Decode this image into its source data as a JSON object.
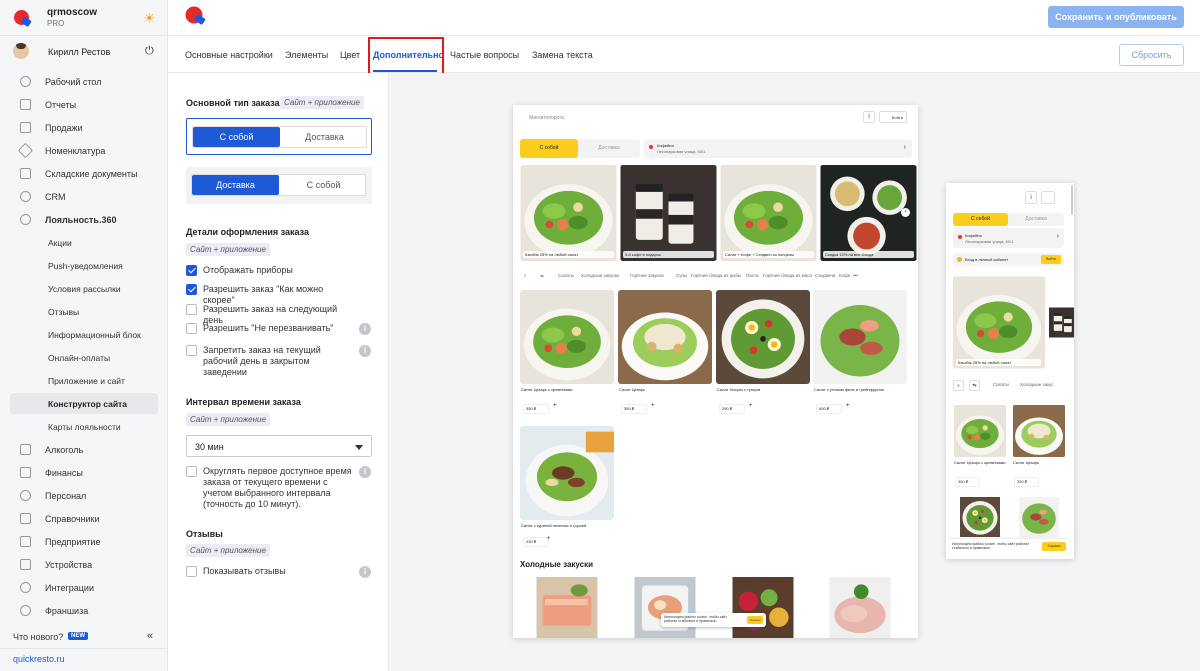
{
  "sidebar": {
    "account_name": "qrmoscow",
    "account_plan": "PRO",
    "user_name": "Кирилл Рестов",
    "nav": [
      "Рабочий стол",
      "Отчеты",
      "Продажи",
      "Номенклатура",
      "Складские документы",
      "CRM",
      "Лояльность.360"
    ],
    "loyalty_sub": [
      "Акции",
      "Push-уведомления",
      "Условия рассылки",
      "Отзывы",
      "Информационный блок",
      "Онлайн-оплаты",
      "Приложение и сайт",
      "Конструктор сайта",
      "Карты лояльности"
    ],
    "nav2": [
      "Алкоголь",
      "Финансы",
      "Персонал",
      "Справочники",
      "Предприятие",
      "Устройства",
      "Интеграции",
      "Франшиза"
    ],
    "whats_new": "Что нового?",
    "new_badge": "NEW",
    "site_link": "quickresto.ru",
    "collapse": "«"
  },
  "topbar": {
    "save_label": "Сохранить и опубликовать"
  },
  "tabs": {
    "items": [
      "Основные настройки",
      "Элементы",
      "Цвет",
      "Дополнительно",
      "Частые вопросы",
      "Замена текста"
    ],
    "active_index": 3,
    "reset_label": "Сбросить"
  },
  "settings": {
    "order_type": {
      "title": "Основной тип заказа",
      "badge": "Сайт + приложение",
      "opt1_a": "С собой",
      "opt1_b": "Доставка",
      "opt2_a": "Доставка",
      "opt2_b": "С собой"
    },
    "details": {
      "title": "Детали оформления заказа",
      "badge": "Сайт + приложение",
      "items": [
        {
          "label": "Отображать приборы",
          "checked": true
        },
        {
          "label": "Разрешить заказ \"Как можно скорее\"",
          "checked": true
        },
        {
          "label": "Разрешить заказ на следующий день",
          "checked": false
        },
        {
          "label": "Разрешить \"Не перезванивать\"",
          "checked": false
        },
        {
          "label": "Запретить заказ на текущий рабочий день в закрытом заведении",
          "checked": false
        }
      ]
    },
    "interval": {
      "title": "Интервал времени заказа",
      "badge": "Сайт + приложение",
      "value": "30 мин",
      "round_label": "Округлять первое доступное время заказа от текущего времени с учетом выбранного интервала (точность до 10 минут)."
    },
    "reviews": {
      "title": "Отзывы",
      "badge": "Сайт + приложение",
      "show_label": "Показывать отзывы"
    },
    "info_glyph": "i"
  },
  "preview": {
    "desktop": {
      "place": "Магнитопорога",
      "info": "i",
      "login": "Войти",
      "seg_a": "С собой",
      "seg_b": "Доставка",
      "addr1": "Кофейня",
      "addr2": "Лесопарковая улица, 60/1",
      "chev": "›",
      "banners": [
        "Кэшбэк 25% на любой салат",
        "5-й кофе в подарок",
        "Салат + Кофе + Сэндвич за полцены",
        "Скидка 10% на все блюда"
      ],
      "categories": [
        "Салаты",
        "Холодные закуски",
        "Горячие закуски",
        "Супы",
        "Горячие блюда из рыбы",
        "Паста",
        "Горячие блюда из мяса",
        "Сэндвичи",
        "Кофе",
        "•••"
      ],
      "products": [
        {
          "name": "Салат Цезарь с креветками",
          "price": "350 ₽"
        },
        {
          "name": "Салат Цезарь",
          "price": "350 ₽"
        },
        {
          "name": "Салат Нисуаз с тунцом",
          "price": "290 ₽"
        },
        {
          "name": "Салат с утиным филе и грейпфрутом",
          "price": "500 ₽"
        },
        {
          "name": "Салат с куриной печенью и грушей",
          "price": "230 ₽"
        }
      ],
      "plus": "+",
      "section_title": "Холодные закуски",
      "cookie_text": "Используем файлы cookie, чтобы сайт работал стабильно и правильно",
      "cookie_ok": "Хорошо"
    },
    "mobile": {
      "info": "i",
      "seg_a": "С собой",
      "seg_b": "Доставка",
      "addr1": "Кофейня",
      "addr2": "Лесопарковая улица, 60/1",
      "lk_text": "Вход в личный кабинет",
      "lk_btn": "Войти",
      "banner": "Кэшбэк 25% на любой салат",
      "categories": [
        "Салаты",
        "Холодные закус"
      ],
      "products": [
        {
          "name": "Салат Цезарь с креветками",
          "price": "350 ₽"
        },
        {
          "name": "Салат Цезарь",
          "price": "350 ₽"
        }
      ],
      "cookie_text": "Используем файлы cookie, чтобы сайт работал стабильно и правильно",
      "cookie_ok": "Хорошо"
    }
  },
  "colors": {
    "accent": "#1f5ad6",
    "highlight": "#e01a1a",
    "brand_yellow": "#fccd1c",
    "save_btn": "#8ab3f0"
  }
}
